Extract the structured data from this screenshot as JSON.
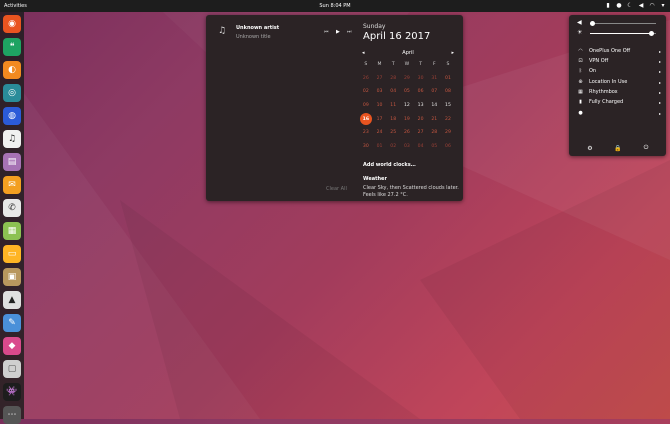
{
  "topbar": {
    "activities": "Activities",
    "clock": "Sun 8:04 PM",
    "tray_icons": [
      "battery-icon",
      "user-icon",
      "night-mode-icon",
      "speaker-icon",
      "network-icon",
      "power-menu-icon"
    ]
  },
  "dock": {
    "apps": [
      {
        "name": "ubuntu-logo-icon",
        "glyph": "◉",
        "bg": "#e95420",
        "fg": "#fff"
      },
      {
        "name": "hangouts-icon",
        "glyph": "❝",
        "bg": "#1ea362",
        "fg": "#fff"
      },
      {
        "name": "firefox-icon",
        "glyph": "◐",
        "bg": "#f28a20",
        "fg": "#fff"
      },
      {
        "name": "web-icon",
        "glyph": "◎",
        "bg": "#2a8c9a",
        "fg": "#fff"
      },
      {
        "name": "disk-icon",
        "glyph": "◍",
        "bg": "#2b5bd8",
        "fg": "#fff"
      },
      {
        "name": "music-icon",
        "glyph": "♫",
        "bg": "#f0f0f0",
        "fg": "#222"
      },
      {
        "name": "files-icon",
        "glyph": "▤",
        "bg": "#a672b4",
        "fg": "#fff"
      },
      {
        "name": "mail-icon",
        "glyph": "✉",
        "bg": "#f39f21",
        "fg": "#fff"
      },
      {
        "name": "phone-icon",
        "glyph": "✆",
        "bg": "#e8e8e8",
        "fg": "#333"
      },
      {
        "name": "calculator-icon",
        "glyph": "▦",
        "bg": "#8cc152",
        "fg": "#fff"
      },
      {
        "name": "notes-icon",
        "glyph": "▭",
        "bg": "#ffb524",
        "fg": "#fff"
      },
      {
        "name": "archive-icon",
        "glyph": "▣",
        "bg": "#b8975e",
        "fg": "#fff"
      },
      {
        "name": "inkscape-icon",
        "glyph": "▲",
        "bg": "#e0e0e0",
        "fg": "#222"
      },
      {
        "name": "text-editor-icon",
        "glyph": "✎",
        "bg": "#4a90d9",
        "fg": "#fff"
      },
      {
        "name": "paint-icon",
        "glyph": "◆",
        "bg": "#d94a8c",
        "fg": "#fff"
      },
      {
        "name": "screenshot-icon",
        "glyph": "▢",
        "bg": "#cfcfcf",
        "fg": "#555"
      },
      {
        "name": "game-icon",
        "glyph": "👾",
        "bg": "#1d1d1d",
        "fg": "#fff"
      },
      {
        "name": "show-apps-icon",
        "glyph": "⋯",
        "bg": "#555",
        "fg": "#fff"
      }
    ]
  },
  "calendar_popup": {
    "media": {
      "artist": "Unknown artist",
      "album": "Unknown title",
      "icons": [
        "music-note-icon",
        "previous-icon",
        "play-icon",
        "next-icon"
      ]
    },
    "clear_all": "Clear All",
    "weekday": "Sunday",
    "date": "April 16 2017",
    "calendar": {
      "month": "April",
      "prev": "◂",
      "next": "▸",
      "day_headers": [
        "S",
        "M",
        "T",
        "W",
        "T",
        "F",
        "S"
      ],
      "weeks": [
        [
          {
            "d": "26",
            "s": "muted"
          },
          {
            "d": "27",
            "s": "muted"
          },
          {
            "d": "28",
            "s": "muted"
          },
          {
            "d": "29",
            "s": "muted"
          },
          {
            "d": "30",
            "s": "muted"
          },
          {
            "d": "31",
            "s": "muted"
          },
          {
            "d": "01",
            "s": "red"
          }
        ],
        [
          {
            "d": "02",
            "s": "red"
          },
          {
            "d": "03",
            "s": "red"
          },
          {
            "d": "04",
            "s": "red"
          },
          {
            "d": "05",
            "s": "red"
          },
          {
            "d": "06",
            "s": "red"
          },
          {
            "d": "07",
            "s": "red"
          },
          {
            "d": "08",
            "s": "red"
          }
        ],
        [
          {
            "d": "09",
            "s": "red"
          },
          {
            "d": "10",
            "s": "red"
          },
          {
            "d": "11",
            "s": "red"
          },
          {
            "d": "12",
            "s": "wk"
          },
          {
            "d": "13",
            "s": "wk"
          },
          {
            "d": "14",
            "s": "wk"
          },
          {
            "d": "15",
            "s": "wk"
          }
        ],
        [
          {
            "d": "16",
            "s": "today"
          },
          {
            "d": "17",
            "s": "red"
          },
          {
            "d": "18",
            "s": "red"
          },
          {
            "d": "19",
            "s": "red"
          },
          {
            "d": "20",
            "s": "red"
          },
          {
            "d": "21",
            "s": "red"
          },
          {
            "d": "22",
            "s": "red"
          }
        ],
        [
          {
            "d": "23",
            "s": "red"
          },
          {
            "d": "24",
            "s": "red"
          },
          {
            "d": "25",
            "s": "red"
          },
          {
            "d": "26",
            "s": "red"
          },
          {
            "d": "27",
            "s": "red"
          },
          {
            "d": "28",
            "s": "red"
          },
          {
            "d": "29",
            "s": "red"
          }
        ],
        [
          {
            "d": "30",
            "s": "red"
          },
          {
            "d": "01",
            "s": "muted"
          },
          {
            "d": "02",
            "s": "muted"
          },
          {
            "d": "03",
            "s": "muted"
          },
          {
            "d": "04",
            "s": "muted"
          },
          {
            "d": "05",
            "s": "muted"
          },
          {
            "d": "06",
            "s": "muted"
          }
        ]
      ]
    },
    "world_clocks": "Add world clocks…",
    "weather": {
      "title": "Weather",
      "line1": "Clear Sky, then Scattered clouds later.",
      "line2": "Feels like 27.2 °C."
    }
  },
  "system_menu": {
    "volume_level": 0.03,
    "brightness_level": 0.92,
    "items": [
      {
        "name": "wifi",
        "icon": "wifi-icon",
        "glyph": "◠",
        "label": "OnePlus One Off",
        "arrow": "▸"
      },
      {
        "name": "vpn",
        "icon": "vpn-icon",
        "glyph": "⊡",
        "label": "VPN Off",
        "arrow": "▸"
      },
      {
        "name": "bluetooth",
        "icon": "bluetooth-icon",
        "glyph": "ᛒ",
        "label": "On",
        "arrow": "▸"
      },
      {
        "name": "location",
        "icon": "location-icon",
        "glyph": "⊕",
        "label": "Location In Use",
        "arrow": "▸"
      },
      {
        "name": "rhythmbox",
        "icon": "rhythmbox-icon",
        "glyph": "▦",
        "label": "Rhythmbox",
        "arrow": "▸"
      },
      {
        "name": "battery",
        "icon": "battery-icon",
        "glyph": "▮",
        "label": "Fully Charged",
        "arrow": "▸"
      },
      {
        "name": "user",
        "icon": "user-icon",
        "glyph": "●",
        "label": "",
        "arrow": "▸"
      }
    ],
    "buttons": [
      {
        "name": "settings-icon",
        "glyph": "⚙"
      },
      {
        "name": "lock-icon",
        "glyph": "🔒"
      },
      {
        "name": "power-icon",
        "glyph": "⏻"
      }
    ]
  }
}
